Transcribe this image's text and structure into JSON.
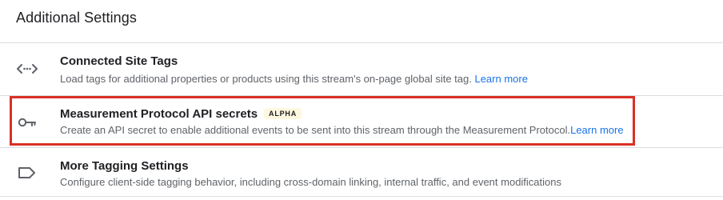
{
  "section": {
    "title": "Additional Settings"
  },
  "rows": [
    {
      "icon": "code-tag-icon",
      "title": "Connected Site Tags",
      "description": "Load tags for additional properties or products using this stream's on-page global site tag.",
      "link": "Learn more"
    },
    {
      "icon": "key-icon",
      "title": "Measurement Protocol API secrets",
      "badge": "ALPHA",
      "description": "Create an API secret to enable additional events to be sent into this stream through the Measurement Protocol.",
      "link": "Learn more"
    },
    {
      "icon": "label-tag-icon",
      "title": "More Tagging Settings",
      "description": "Configure client-side tagging behavior, including cross-domain linking, internal traffic, and event modifications"
    }
  ],
  "colors": {
    "highlight": "#d93025",
    "link": "#1a73e8",
    "badge_bg": "#fef7e0"
  }
}
